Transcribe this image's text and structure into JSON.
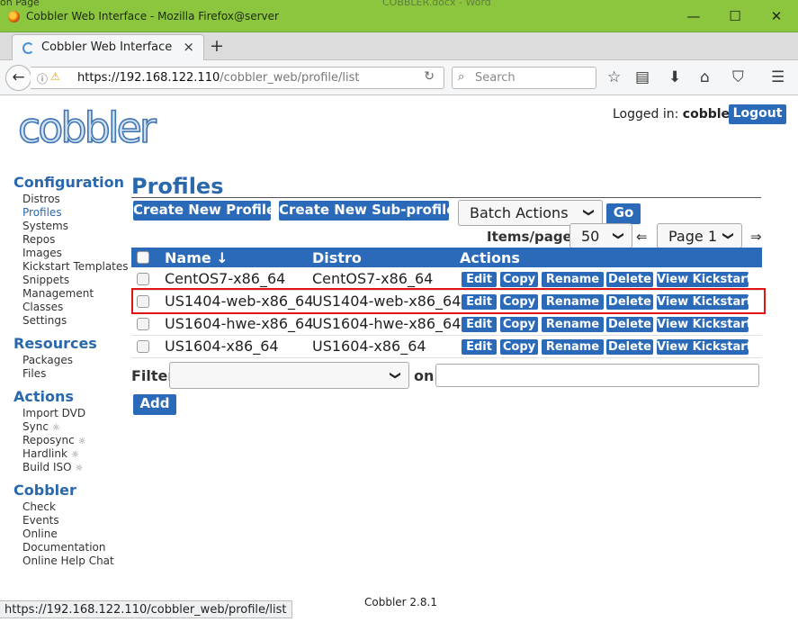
{
  "window": {
    "title": "Cobbler Web Interface - Mozilla Firefox@server",
    "bg_text_left": "on Page",
    "bg_text_center": "COBBLER.docx - Word",
    "minimize": "—",
    "maximize": "☐",
    "close": "✕"
  },
  "tabbar": {
    "tab_title": "Cobbler Web Interface",
    "tab_close": "×",
    "new_tab": "+"
  },
  "navbar": {
    "url_host": "https://192.168.122.110",
    "url_path": "/cobbler_web/profile/list",
    "search_placeholder": "Search"
  },
  "header": {
    "logo_text": "cobbler",
    "logged_in_label": "Logged in:",
    "user": "cobbler",
    "logout": "Logout"
  },
  "sidebar": {
    "configuration": {
      "heading": "Configuration",
      "items": [
        "Distros",
        "Profiles",
        "Systems",
        "Repos",
        "Images",
        "Kickstart Templates",
        "Snippets",
        "Management",
        "Classes",
        "Settings"
      ]
    },
    "resources": {
      "heading": "Resources",
      "items": [
        "Packages",
        "Files"
      ]
    },
    "actions": {
      "heading": "Actions",
      "items": [
        "Import DVD",
        "Sync",
        "Reposync",
        "Hardlink",
        "Build ISO"
      ]
    },
    "cobbler": {
      "heading": "Cobbler",
      "items": [
        "Check",
        "Events",
        "Online",
        "Documentation",
        "Online Help Chat"
      ]
    }
  },
  "main": {
    "title": "Profiles",
    "create_profile": "Create New Profile",
    "create_subprofile": "Create New Sub-profile",
    "batch_actions": "Batch Actions",
    "go": "Go",
    "items_per_page_label": "Items/page:",
    "items_per_page": "50",
    "prev_arrow": "⇐",
    "page": "Page 1",
    "next_arrow": "⇒",
    "columns": [
      "Name ↓",
      "Distro",
      "Actions"
    ],
    "rows": [
      {
        "name": "CentOS7-x86_64",
        "distro": "CentOS7-x86_64"
      },
      {
        "name": "US1404-web-x86_64",
        "distro": "US1404-web-x86_64"
      },
      {
        "name": "US1604-hwe-x86_64",
        "distro": "US1604-hwe-x86_64"
      },
      {
        "name": "US1604-x86_64",
        "distro": "US1604-x86_64"
      }
    ],
    "row_actions": [
      "Edit",
      "Copy",
      "Rename",
      "Delete",
      "View Kickstart"
    ],
    "filter_label": "Filter",
    "on_label": "on",
    "add": "Add"
  },
  "footer": {
    "version": "Cobbler 2.8.1"
  },
  "statusbar": {
    "url": "https://192.168.122.110/cobbler_web/profile/list"
  }
}
